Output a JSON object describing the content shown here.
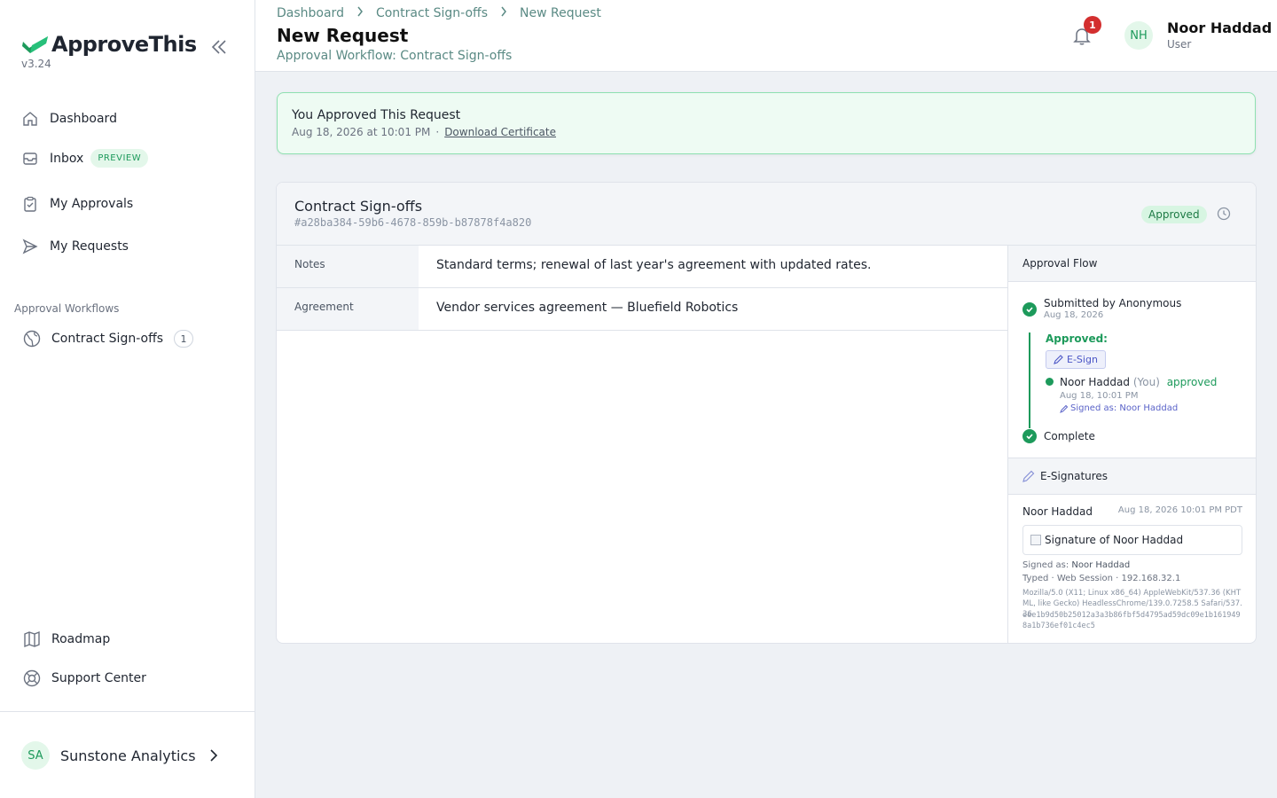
{
  "app": {
    "name": "ApproveThis",
    "version": "v3.24",
    "brand_color": "#1d9a5b"
  },
  "sidebar": {
    "items": [
      {
        "label": "Dashboard",
        "icon": "home-icon"
      },
      {
        "label": "Inbox",
        "icon": "inbox-icon",
        "badge": "PREVIEW"
      },
      {
        "label": "My Approvals",
        "icon": "clipboard-check-icon"
      },
      {
        "label": "My Requests",
        "icon": "send-icon"
      }
    ],
    "section_label": "Approval Workflows",
    "workflows": [
      {
        "label": "Contract Sign-offs",
        "count": "1",
        "icon": "globe-icon"
      }
    ],
    "bottom_items": [
      {
        "label": "Roadmap",
        "icon": "map-icon"
      },
      {
        "label": "Support Center",
        "icon": "lifebuoy-icon"
      }
    ],
    "org": {
      "initials": "SA",
      "name": "Sunstone Analytics"
    }
  },
  "header": {
    "breadcrumbs": [
      "Dashboard",
      "Contract Sign-offs",
      "New Request"
    ],
    "title": "New Request",
    "subtitle": "Approval Workflow: Contract Sign-offs",
    "notification_count": "1",
    "user": {
      "initials": "NH",
      "name": "Noor Haddad",
      "role": "User"
    }
  },
  "alert": {
    "title": "You Approved This Request",
    "timestamp": "Aug 18, 2026 at 10:01 PM",
    "separator": "·",
    "link": "Download Certificate"
  },
  "request": {
    "title": "Contract Sign-offs",
    "id": "#a28ba384-59b6-4678-859b-b87878f4a820",
    "status": "Approved",
    "fields": [
      {
        "key": "Notes",
        "value": "Standard terms; renewal of last year's agreement with updated rates."
      },
      {
        "key": "Agreement",
        "value": "Vendor services agreement — Bluefield Robotics"
      }
    ]
  },
  "approval_flow": {
    "heading": "Approval Flow",
    "submitted": "Submitted by Anonymous",
    "submitted_date": "Aug 18, 2026",
    "approved_label": "Approved:",
    "esign_chip": "E-Sign",
    "approver_name": "Noor Haddad",
    "approver_you": "(You)",
    "approver_status": "approved",
    "approver_time": "Aug 18, 10:01 PM",
    "signed_as": "Signed as: Noor Haddad",
    "complete": "Complete"
  },
  "esignatures": {
    "heading": "E-Signatures",
    "name": "Noor Haddad",
    "date": "Aug 18, 2026 10:01 PM PDT",
    "image_alt": "Signature of Noor Haddad",
    "signed_as_label": "Signed as:",
    "signed_as_name": "Noor Haddad",
    "method": "Typed · Web Session · 192.168.32.1",
    "user_agent": "Mozilla/5.0 (X11; Linux x86_64) AppleWebKit/537.36 (KHTML, like Gecko) HeadlessChrome/139.0.7258.5 Safari/537.36",
    "hash": "eee1b9d50b25012a3a3b86fbf5d4795ad59dc09e1b1619498a1b736ef01c4ec5"
  }
}
